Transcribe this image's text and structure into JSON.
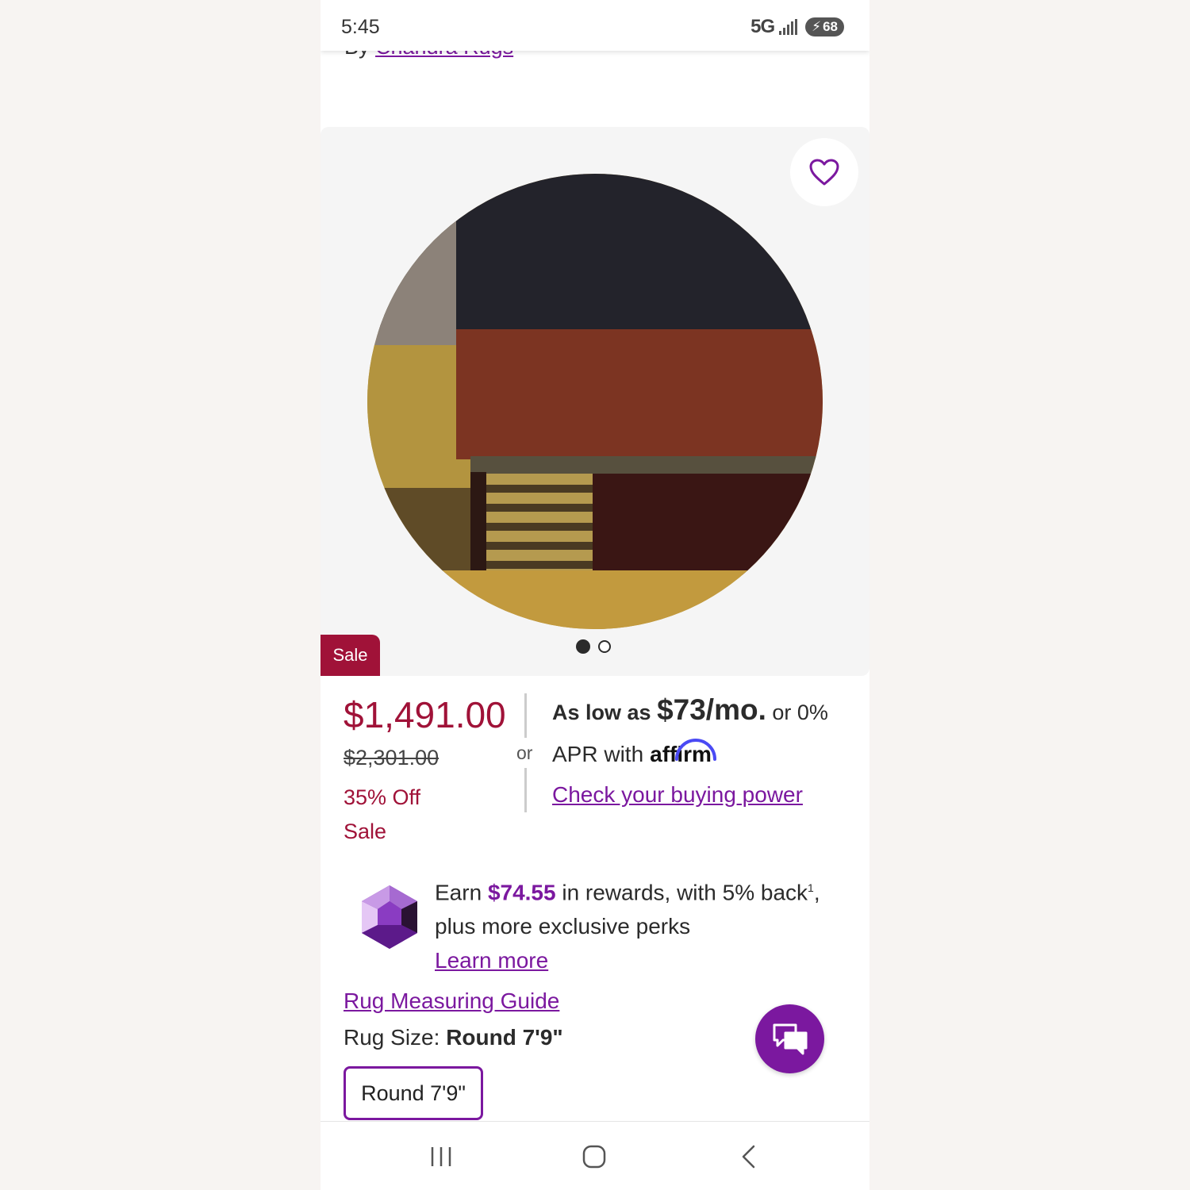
{
  "status_bar": {
    "time": "5:45",
    "network": "5G",
    "battery": "68"
  },
  "brand": {
    "prefix": "By",
    "name": "Chandra Rugs"
  },
  "carousel": {
    "sale_badge": "Sale",
    "slide_count": 2,
    "active_slide": 1
  },
  "pricing": {
    "price": "$1,491.00",
    "original_price": "$2,301.00",
    "discount": "35% Off",
    "sale_label": "Sale",
    "or_label": "or"
  },
  "financing": {
    "as_low_as": "As low as",
    "monthly": "$73/mo.",
    "or_zero": "or 0%",
    "apr_with": "APR with",
    "affirm_logo": "affirm",
    "check_link": "Check your buying power"
  },
  "rewards": {
    "earn": "Earn",
    "amount": "$74.55",
    "rest": "in rewards, with 5% back",
    "footnote": "1",
    "suffix": ",",
    "line2": "plus more exclusive perks",
    "learn_more": "Learn more"
  },
  "size": {
    "guide_link": "Rug Measuring Guide",
    "label": "Rug Size:",
    "selected": "Round 7'9\"",
    "option": "Round 7'9\""
  },
  "icons": {
    "favorite": "heart-icon",
    "chat": "chat-icon",
    "rewards": "gem-icon"
  },
  "colors": {
    "accent": "#7b189f",
    "sale": "#a01238"
  }
}
